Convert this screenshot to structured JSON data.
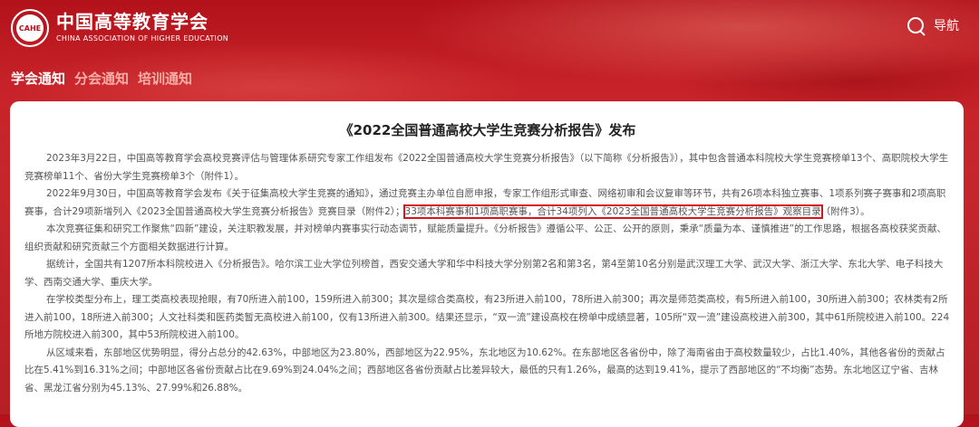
{
  "header": {
    "logo_emblem_text": "CAHE",
    "logo_cn": "中国高等教育学会",
    "logo_en": "CHINA ASSOCIATION OF HIGHER EDUCATION",
    "nav_label": "导航"
  },
  "tabs": [
    {
      "label": "学会通知",
      "active": true
    },
    {
      "label": "分会通知",
      "active": false
    },
    {
      "label": "培训通知",
      "active": false
    }
  ],
  "article": {
    "title": "《2022全国普通高校大学生竞赛分析报告》发布",
    "p1": "2023年3月22日，中国高等教育学会高校竞赛评估与管理体系研究专家工作组发布《2022全国普通高校大学生竞赛分析报告》（以下简称《分析报告》），其中包含普通本科院校大学生竞赛榜单13个、高职院校大学生竞赛榜单11个、省份大学生竞赛榜单3个（附件1）。",
    "p2a": "2022年9月30日，中国高等教育学会发布《关于征集高校大学生竞赛的通知》，通过竞赛主办单位自愿申报，专家工作组形式审查、网络初审和会议复审等环节，共有26项本科独立赛事、1项系列赛子赛事和2项高职赛事，合计29项新增列入《2023全国普通高校大学生竞赛分析报告》竞赛目录（附件2）；",
    "p2b": "33项本科赛事和1项高职赛事，合计34项列入《2023全国普通高校大学生竞赛分析报告》观察目录",
    "p2c": "（附件3）。",
    "p3": "本次竞赛征集和研究工作聚焦“四新”建设，关注职教发展，并对榜单内赛事实行动态调节，赋能质量提升。《分析报告》遵循公平、公正、公开的原则，秉承“质量为本、谨慎推进”的工作思路，根据各高校获奖贡献、组织贡献和研究贡献三个方面相关数据进行计算。",
    "p4": "据统计，全国共有1207所本科院校进入《分析报告》。哈尔滨工业大学位列榜首，西安交通大学和华中科技大学分别第2名和第3名，第4至第10名分别是武汉理工大学、武汉大学、浙江大学、东北大学、电子科技大学、西南交通大学、重庆大学。",
    "p5": "在学校类型分布上，理工类高校表现抢眼，有70所进入前100，159所进入前300；其次是综合类高校，有23所进入前100，78所进入前300；再次是师范类高校，有5所进入前100，30所进入前300；农林类有2所进入前100，18所进入前300；人文社科类和医药类暂无高校进入前100，仅有13所进入前300。结果还显示，“双一流”建设高校在榜单中成绩显著，105所“双一流”建设高校进入前300，其中61所院校进入前100。224所地方院校进入前300，其中53所院校进入前100。",
    "p6": "从区域来看，东部地区优势明显，得分占总分的42.63%，中部地区为23.80%，西部地区为22.95%，东北地区为10.62%。在东部地区各省份中，除了海南省由于高校数量较少，占比1.40%，其他各省份的贡献占比在5.41%到16.31%之间；中部地区各省份贡献占比在9.69%到24.04%之间；西部地区各省份贡献占比差异较大，最低的只有1.26%，最高的达到19.41%，提示了西部地区的“不均衡”态势。东北地区辽宁省、吉林省、黑龙江省分别为45.13%、27.99%和26.88%。"
  },
  "colors": {
    "brand_red": "#c8232a",
    "highlight_border": "#d8141c"
  }
}
